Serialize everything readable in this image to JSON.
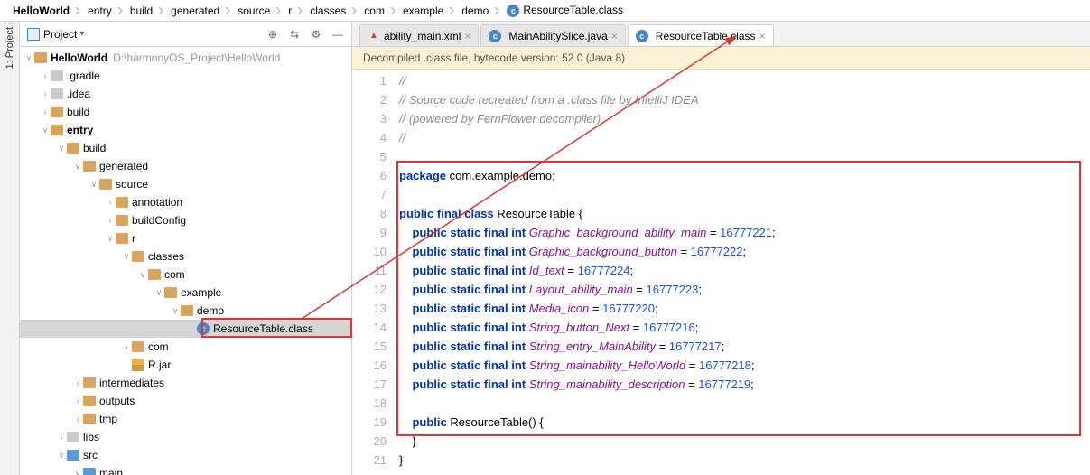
{
  "breadcrumb": [
    "HelloWorld",
    "entry",
    "build",
    "generated",
    "source",
    "r",
    "classes",
    "com",
    "example",
    "demo",
    "ResourceTable.class"
  ],
  "project": {
    "title": "Project",
    "root": {
      "name": "HelloWorld",
      "path": "D:\\harmonyOS_Project\\HelloWorld"
    },
    "nodes": [
      {
        "depth": 1,
        "arrow": ">",
        "icon": "folder-grey",
        "label": ".gradle"
      },
      {
        "depth": 1,
        "arrow": ">",
        "icon": "folder-grey",
        "label": ".idea"
      },
      {
        "depth": 1,
        "arrow": ">",
        "icon": "folder",
        "label": "build"
      },
      {
        "depth": 1,
        "arrow": "v",
        "icon": "folder",
        "label": "entry",
        "bold": true
      },
      {
        "depth": 2,
        "arrow": "v",
        "icon": "folder",
        "label": "build"
      },
      {
        "depth": 3,
        "arrow": "v",
        "icon": "folder",
        "label": "generated"
      },
      {
        "depth": 4,
        "arrow": "v",
        "icon": "folder",
        "label": "source"
      },
      {
        "depth": 5,
        "arrow": ">",
        "icon": "folder",
        "label": "annotation"
      },
      {
        "depth": 5,
        "arrow": ">",
        "icon": "folder",
        "label": "buildConfig"
      },
      {
        "depth": 5,
        "arrow": "v",
        "icon": "folder",
        "label": "r"
      },
      {
        "depth": 6,
        "arrow": "v",
        "icon": "folder",
        "label": "classes"
      },
      {
        "depth": 7,
        "arrow": "v",
        "icon": "folder",
        "label": "com"
      },
      {
        "depth": 8,
        "arrow": "v",
        "icon": "folder",
        "label": "example"
      },
      {
        "depth": 9,
        "arrow": "v",
        "icon": "folder",
        "label": "demo"
      },
      {
        "depth": 10,
        "arrow": "",
        "icon": "class",
        "label": "ResourceTable.class",
        "selected": true
      },
      {
        "depth": 6,
        "arrow": ">",
        "icon": "folder",
        "label": "com"
      },
      {
        "depth": 6,
        "arrow": "",
        "icon": "jar",
        "label": "R.jar"
      },
      {
        "depth": 3,
        "arrow": ">",
        "icon": "folder",
        "label": "intermediates"
      },
      {
        "depth": 3,
        "arrow": ">",
        "icon": "folder",
        "label": "outputs"
      },
      {
        "depth": 3,
        "arrow": ">",
        "icon": "folder",
        "label": "tmp"
      },
      {
        "depth": 2,
        "arrow": ">",
        "icon": "folder-grey",
        "label": "libs"
      },
      {
        "depth": 2,
        "arrow": "v",
        "icon": "folder-blue",
        "label": "src"
      },
      {
        "depth": 3,
        "arrow": "v",
        "icon": "folder-blue",
        "label": "main"
      }
    ]
  },
  "tabs": [
    {
      "icon": "xml",
      "label": "ability_main.xml",
      "active": false
    },
    {
      "icon": "class",
      "label": "MainAbilitySlice.java",
      "active": false
    },
    {
      "icon": "class",
      "label": "ResourceTable.class",
      "active": true
    }
  ],
  "banner": "Decompiled .class file, bytecode version: 52.0 (Java 8)",
  "code": {
    "lines": [
      {
        "n": 1,
        "t": "cmt",
        "v": "//"
      },
      {
        "n": 2,
        "t": "cmt",
        "v": "// Source code recreated from a .class file by IntelliJ IDEA"
      },
      {
        "n": 3,
        "t": "cmt",
        "v": "// (powered by FernFlower decompiler)"
      },
      {
        "n": 4,
        "t": "cmt",
        "v": "//"
      },
      {
        "n": 5,
        "t": "blank",
        "v": ""
      },
      {
        "n": 6,
        "t": "pkg",
        "v": "package com.example.demo;"
      },
      {
        "n": 7,
        "t": "blank",
        "v": ""
      },
      {
        "n": 8,
        "t": "cls",
        "v": "public final class ResourceTable {"
      },
      {
        "n": 9,
        "t": "fld",
        "name": "Graphic_background_ability_main",
        "val": "16777221"
      },
      {
        "n": 10,
        "t": "fld",
        "name": "Graphic_background_button",
        "val": "16777222"
      },
      {
        "n": 11,
        "t": "fld",
        "name": "Id_text",
        "val": "16777224"
      },
      {
        "n": 12,
        "t": "fld",
        "name": "Layout_ability_main",
        "val": "16777223"
      },
      {
        "n": 13,
        "t": "fld",
        "name": "Media_icon",
        "val": "16777220"
      },
      {
        "n": 14,
        "t": "fld",
        "name": "String_button_Next",
        "val": "16777216"
      },
      {
        "n": 15,
        "t": "fld",
        "name": "String_entry_MainAbility",
        "val": "16777217"
      },
      {
        "n": 16,
        "t": "fld",
        "name": "String_mainability_HelloWorld",
        "val": "16777218"
      },
      {
        "n": 17,
        "t": "fld",
        "name": "String_mainability_description",
        "val": "16777219"
      },
      {
        "n": 18,
        "t": "blank",
        "v": ""
      },
      {
        "n": 19,
        "t": "ctor",
        "v": "    public ResourceTable() {"
      },
      {
        "n": 20,
        "t": "plain",
        "v": "    }"
      },
      {
        "n": 21,
        "t": "plain",
        "v": "}"
      }
    ]
  },
  "sideTab": "1: Project"
}
